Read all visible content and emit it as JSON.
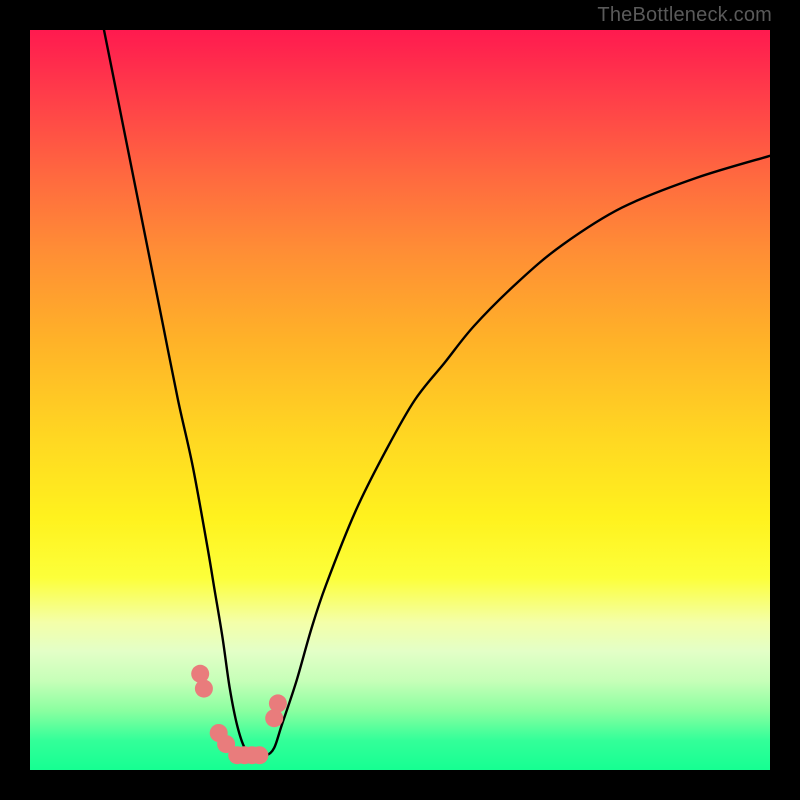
{
  "watermark": "TheBottleneck.com",
  "chart_data": {
    "type": "line",
    "title": "",
    "xlabel": "",
    "ylabel": "",
    "xlim": [
      0,
      100
    ],
    "ylim": [
      0,
      100
    ],
    "series": [
      {
        "name": "curve",
        "x": [
          10,
          12,
          14,
          16,
          18,
          20,
          22,
          24,
          25,
          26,
          27,
          28,
          29,
          30,
          31,
          32,
          33,
          34,
          36,
          38,
          40,
          44,
          48,
          52,
          56,
          60,
          66,
          72,
          80,
          90,
          100
        ],
        "values": [
          100,
          90,
          80,
          70,
          60,
          50,
          41,
          30,
          24,
          18,
          11,
          6,
          3,
          2,
          2,
          2,
          3,
          6,
          12,
          19,
          25,
          35,
          43,
          50,
          55,
          60,
          66,
          71,
          76,
          80,
          83
        ]
      }
    ],
    "markers": {
      "name": "dots",
      "color": "#e97c7c",
      "x": [
        23.0,
        23.5,
        25.5,
        26.5,
        28.0,
        29.0,
        30.0,
        31.0,
        33.0,
        33.5
      ],
      "values": [
        13.0,
        11.0,
        5.0,
        3.5,
        2.0,
        2.0,
        2.0,
        2.0,
        7.0,
        9.0
      ]
    },
    "background_gradient": {
      "top": "#ff1a4f",
      "mid": "#fff21e",
      "bottom": "#16ff92"
    }
  }
}
